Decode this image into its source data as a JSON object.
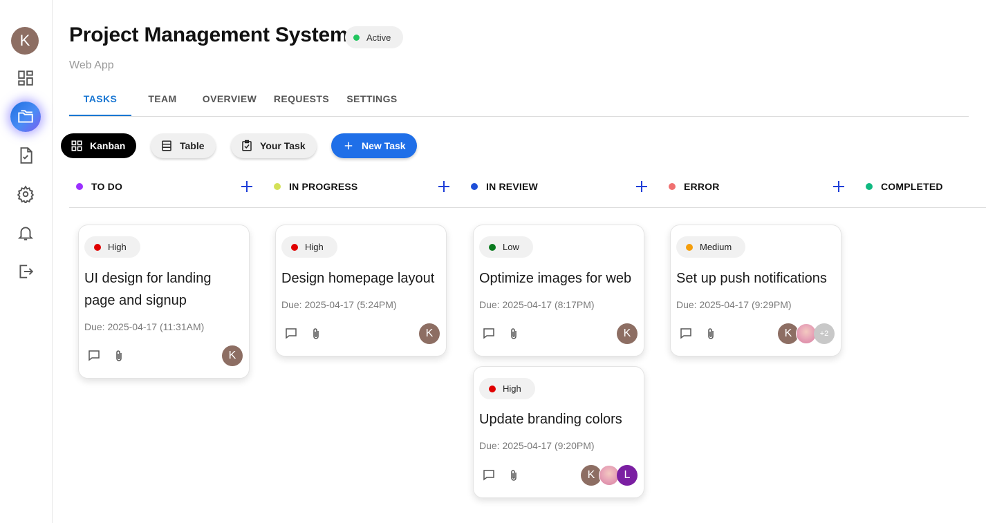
{
  "sidebar": {
    "avatar_initial": "K",
    "icons": [
      "dashboard-icon",
      "folder-icon",
      "task-document-icon",
      "settings-icon",
      "notifications-icon",
      "logout-icon"
    ]
  },
  "header": {
    "title": "Project Management System",
    "status": "Active",
    "status_color": "#22c55e",
    "subtitle": "Web App"
  },
  "tabs": [
    {
      "label": "TASKS",
      "active": true
    },
    {
      "label": "TEAM",
      "active": false
    },
    {
      "label": "OVERVIEW",
      "active": false
    },
    {
      "label": "REQUESTS",
      "active": false
    },
    {
      "label": "SETTINGS",
      "active": false
    }
  ],
  "toolbar": {
    "kanban_label": "Kanban",
    "table_label": "Table",
    "your_task_label": "Your Task",
    "new_task_label": "New Task"
  },
  "columns": [
    {
      "name": "TO DO",
      "color": "#9b30ff"
    },
    {
      "name": "IN PROGRESS",
      "color": "#d4e157"
    },
    {
      "name": "IN REVIEW",
      "color": "#1e4fd8"
    },
    {
      "name": "ERROR",
      "color": "#f07070"
    },
    {
      "name": "COMPLETED",
      "color": "#10b981"
    }
  ],
  "cards": [
    {
      "priority": "High",
      "priority_color": "#e00000",
      "title": "UI design for landing page and signup",
      "due": "Due: 2025-04-17 (11:31AM)",
      "assignees": [
        "K"
      ]
    },
    {
      "priority": "High",
      "priority_color": "#e00000",
      "title": "Design homepage layout",
      "due": "Due: 2025-04-17 (5:24PM)",
      "assignees": [
        "K"
      ]
    },
    {
      "priority": "Low",
      "priority_color": "#0a7a1e",
      "title": "Optimize images for web",
      "due": "Due: 2025-04-17 (8:17PM)",
      "assignees": [
        "K"
      ]
    },
    {
      "priority": "High",
      "priority_color": "#e00000",
      "title": "Update branding colors",
      "due": "Due: 2025-04-17 (9:20PM)",
      "assignees": [
        "K",
        "photo",
        "L"
      ]
    },
    {
      "priority": "Medium",
      "priority_color": "#f59e0b",
      "title": "Set up push notifications",
      "due": "Due: 2025-04-17 (9:29PM)",
      "assignees": [
        "K",
        "photo"
      ],
      "more_assignees": "+2"
    }
  ]
}
